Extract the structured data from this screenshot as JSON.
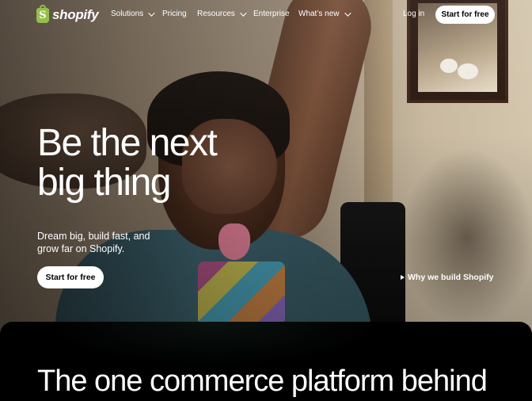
{
  "brand": {
    "name": "shopify",
    "logo_glyph": "S",
    "logo_color": "#95bf47"
  },
  "nav": {
    "items": [
      {
        "label": "Solutions",
        "dropdown": true
      },
      {
        "label": "Pricing",
        "dropdown": false
      },
      {
        "label": "Resources",
        "dropdown": true
      },
      {
        "label": "Enterprise",
        "dropdown": false
      },
      {
        "label": "What’s new",
        "dropdown": true
      }
    ],
    "login": "Log in",
    "cta": "Start for free"
  },
  "hero": {
    "headline_line1": "Be the next",
    "headline_line2": "big thing",
    "subtext": "Dream big, build fast, and grow far on Shopify.",
    "cta": "Start for free",
    "video_link": "Why we build Shopify"
  },
  "section": {
    "heading": "The one commerce platform behind"
  }
}
